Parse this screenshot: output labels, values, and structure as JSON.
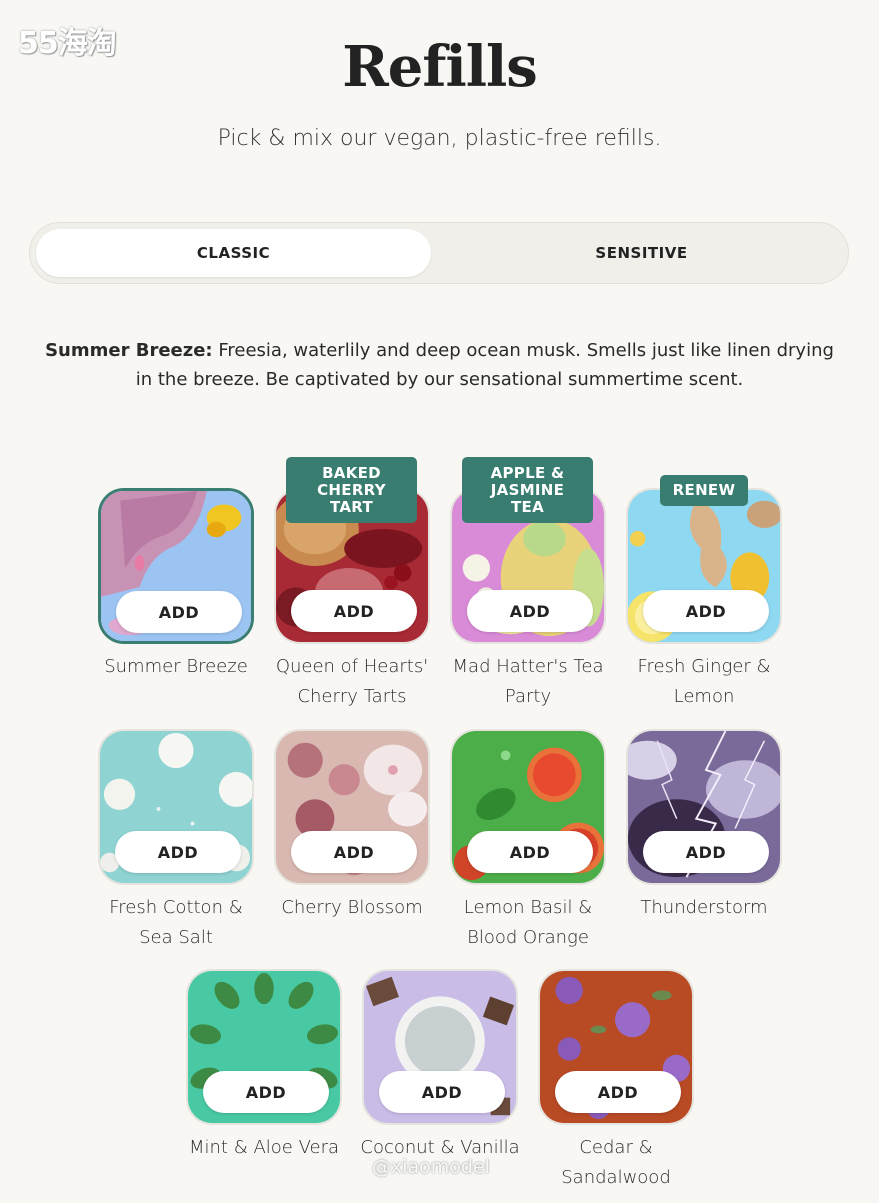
{
  "watermarks": {
    "top": "55海淘",
    "bottom": "@xiaomodel"
  },
  "header": {
    "title": "Refills",
    "subtitle": "Pick & mix our vegan, plastic-free refills."
  },
  "toggle": {
    "classic_label": "CLASSIC",
    "sensitive_label": "SENSITIVE",
    "selected": "CLASSIC"
  },
  "description": {
    "scent_name": "Summer Breeze:",
    "text": "Freesia, waterlily and deep ocean musk. Smells just like linen drying in the breeze. Be captivated by our sensational summertime scent."
  },
  "colors": {
    "accent": "#397d71",
    "background": "#f8f7f3"
  },
  "products": [
    {
      "name": "Summer Breeze",
      "add_label": "ADD",
      "badge": "",
      "selected": true
    },
    {
      "name": "Queen of Hearts' Cherry Tarts",
      "add_label": "ADD",
      "badge": "BAKED CHERRY TART"
    },
    {
      "name": "Mad Hatter's Tea Party",
      "add_label": "ADD",
      "badge": "APPLE & JASMINE TEA"
    },
    {
      "name": "Fresh Ginger & Lemon",
      "add_label": "ADD",
      "badge": "RENEW"
    },
    {
      "name": "Fresh Cotton & Sea Salt",
      "add_label": "ADD",
      "badge": ""
    },
    {
      "name": "Cherry Blossom",
      "add_label": "ADD",
      "badge": ""
    },
    {
      "name": "Lemon Basil & Blood Orange",
      "add_label": "ADD",
      "badge": ""
    },
    {
      "name": "Thunderstorm",
      "add_label": "ADD",
      "badge": ""
    },
    {
      "name": "Mint & Aloe Vera",
      "add_label": "ADD",
      "badge": ""
    },
    {
      "name": "Coconut & Vanilla",
      "add_label": "ADD",
      "badge": ""
    },
    {
      "name": "Cedar & Sandalwood",
      "add_label": "ADD",
      "badge": ""
    }
  ]
}
